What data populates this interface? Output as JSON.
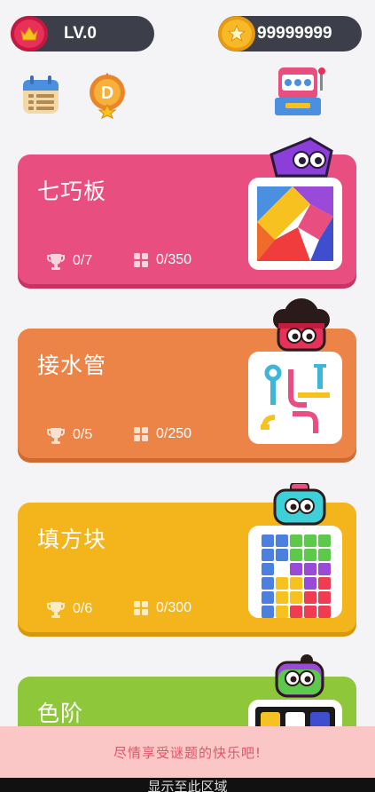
{
  "header": {
    "level_label": "LV.0",
    "coins": "99999999"
  },
  "shortcuts": [
    {
      "name": "calendar-icon"
    },
    {
      "name": "d-medal-icon",
      "letter": "D"
    },
    {
      "name": "slot-machine-icon"
    }
  ],
  "games": [
    {
      "title": "七巧板",
      "trophies": "0/7",
      "levels": "0/350",
      "color": "#e84e7f"
    },
    {
      "title": "接水管",
      "trophies": "0/5",
      "levels": "0/250",
      "color": "#ec8448"
    },
    {
      "title": "填方块",
      "trophies": "0/6",
      "levels": "0/300",
      "color": "#f3b41c"
    },
    {
      "title": "色阶",
      "color": "#8ec73a"
    }
  ],
  "banner": {
    "text": "尽情享受谜题的快乐吧!"
  },
  "bottom_bar": {
    "text": "显示至此区域"
  }
}
